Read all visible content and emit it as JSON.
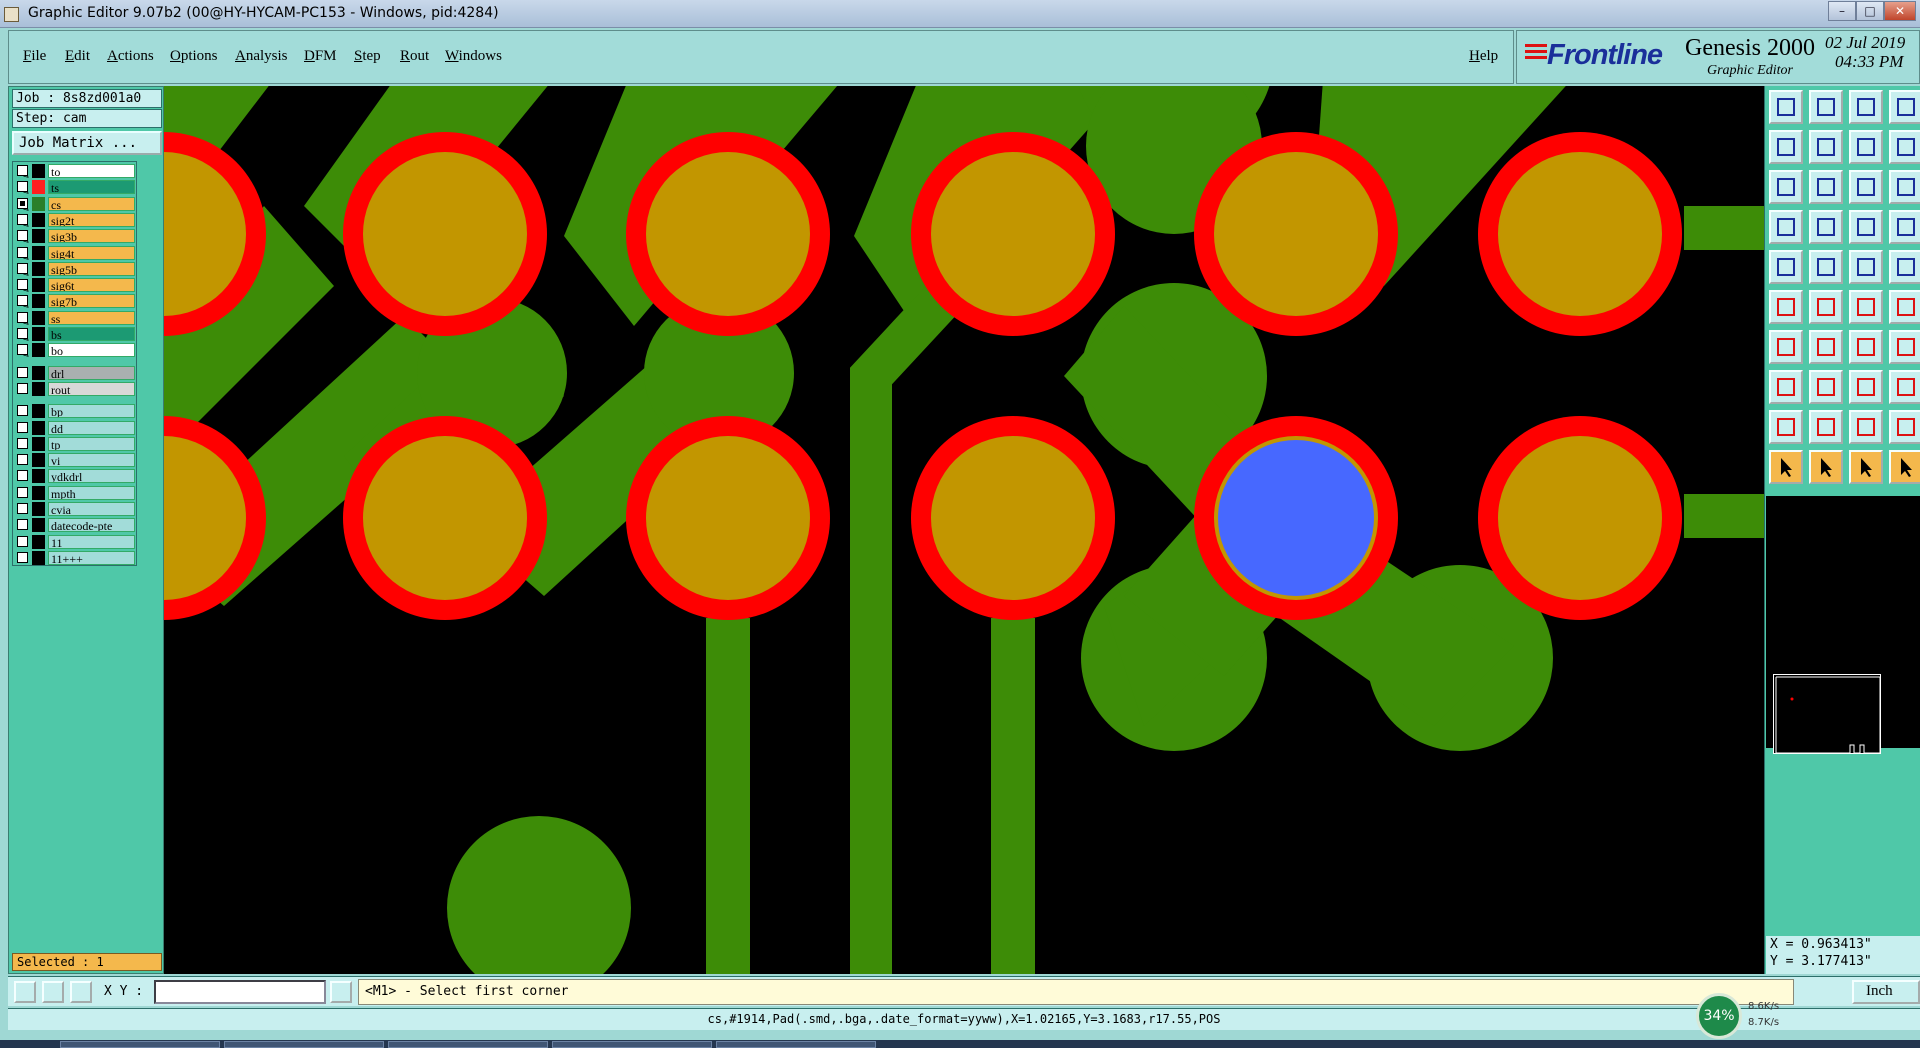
{
  "window": {
    "title": "Graphic Editor 9.07b2 (00@HY-HYCAM-PC153 - Windows, pid:4284)",
    "buttons": [
      "–",
      "□",
      "✕"
    ]
  },
  "menu": {
    "items": [
      "File",
      "Edit",
      "Actions",
      "Options",
      "Analysis",
      "DFM",
      "Step",
      "Rout",
      "Windows"
    ],
    "help": "Help"
  },
  "brand": {
    "logo": "Frontline",
    "product": "Genesis 2000",
    "subtitle": "Graphic Editor",
    "date": "02 Jul 2019",
    "time": "04:33 PM"
  },
  "job": {
    "job_label": "Job : 8s8zd001a0",
    "step_label": "Step: cam",
    "matrix_button": "Job Matrix ..."
  },
  "layers": {
    "board": [
      {
        "name": "to",
        "color": "#ffffff",
        "mark": "#000000",
        "checked": false
      },
      {
        "name": "ts",
        "color": "#1c9a73",
        "mark": "#ff2020",
        "checked": false
      },
      {
        "name": "cs",
        "color": "#f4b84c",
        "mark": "#2a7f2a",
        "checked": true,
        "work": true
      },
      {
        "name": "sig2t",
        "color": "#f4b84c",
        "mark": "#000000",
        "checked": false
      },
      {
        "name": "sig3b",
        "color": "#f4b84c",
        "mark": "#000000",
        "checked": false
      },
      {
        "name": "sig4t",
        "color": "#f4b84c",
        "mark": "#000000",
        "checked": false
      },
      {
        "name": "sig5b",
        "color": "#f4b84c",
        "mark": "#000000",
        "checked": false
      },
      {
        "name": "sig6t",
        "color": "#f4b84c",
        "mark": "#000000",
        "checked": false
      },
      {
        "name": "sig7b",
        "color": "#f4b84c",
        "mark": "#000000",
        "checked": false
      },
      {
        "name": "ss",
        "color": "#f4b84c",
        "mark": "#000000",
        "checked": false
      },
      {
        "name": "bs",
        "color": "#1c9a73",
        "mark": "#000000",
        "checked": false
      },
      {
        "name": "bo",
        "color": "#ffffff",
        "mark": "#000000",
        "checked": false
      }
    ],
    "drill": [
      {
        "name": "drl",
        "color": "#a9b0b0"
      },
      {
        "name": "rout",
        "color": "#d8d8d8"
      }
    ],
    "misc": [
      {
        "name": "bp"
      },
      {
        "name": "dd"
      },
      {
        "name": "tp"
      },
      {
        "name": "vi"
      },
      {
        "name": "ydkdrl"
      },
      {
        "name": "mpth"
      },
      {
        "name": "cvia"
      },
      {
        "name": "datecode-pte"
      },
      {
        "name": "11"
      },
      {
        "name": "11+++"
      }
    ]
  },
  "selected_label": "Selected : 1",
  "coords": {
    "x": "X = 0.963413\"",
    "y": "Y = 3.177413\""
  },
  "cmd": {
    "xy_label": "X Y :",
    "xy_value": "",
    "prompt": "<M1> - Select first corner",
    "units": "Inch"
  },
  "status_line": "cs,#1914,Pad(.smd,.bga,.date_format=yyww),X=1.02165,Y=3.1683,r17.55,POS",
  "netmeter": {
    "percent": "34%",
    "up": "8.6K/s",
    "down": "8.7K/s"
  },
  "colors": {
    "canvas": "#000000",
    "copper": "#3d8c07",
    "mask": "#ff0000",
    "pad": "#c29600",
    "selected": "#4768ff"
  }
}
